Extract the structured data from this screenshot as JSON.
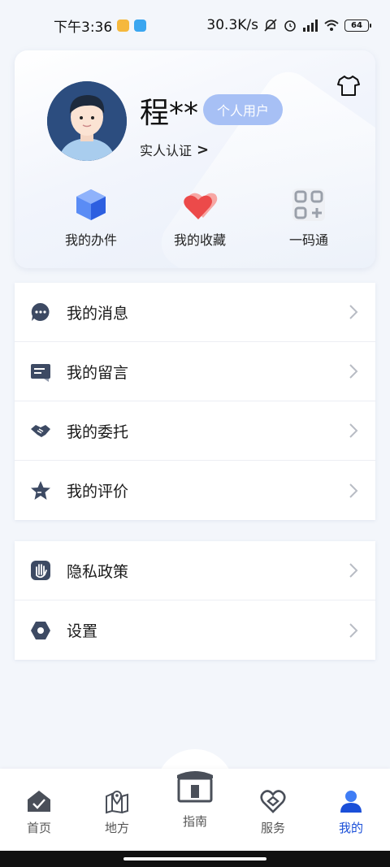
{
  "status": {
    "time": "下午3:36",
    "network_speed": "30.3K/s",
    "battery": "64"
  },
  "profile": {
    "name": "程**",
    "badge": "个人用户",
    "verify_label": "实人认证",
    "verify_arrow": ">"
  },
  "quick_actions": [
    {
      "label": "我的办件",
      "icon": "cube-icon"
    },
    {
      "label": "我的收藏",
      "icon": "hearts-icon"
    },
    {
      "label": "一码通",
      "icon": "qr-code-icon"
    }
  ],
  "menu_group_1": [
    {
      "label": "我的消息",
      "icon": "message-icon"
    },
    {
      "label": "我的留言",
      "icon": "note-icon"
    },
    {
      "label": "我的委托",
      "icon": "handshake-icon"
    },
    {
      "label": "我的评价",
      "icon": "star-icon"
    }
  ],
  "menu_group_2": [
    {
      "label": "隐私政策",
      "icon": "hand-icon"
    },
    {
      "label": "设置",
      "icon": "settings-icon"
    }
  ],
  "tabs": [
    {
      "label": "首页",
      "icon": "home-icon"
    },
    {
      "label": "地方",
      "icon": "map-icon"
    },
    {
      "label": "指南",
      "icon": "guide-book-icon"
    },
    {
      "label": "服务",
      "icon": "heart-service-icon"
    },
    {
      "label": "我的",
      "icon": "user-icon",
      "active": true
    }
  ],
  "colors": {
    "accent": "#1a4fd8",
    "badge_bg": "#a7c0f5",
    "icon_dark": "#3d4a63"
  }
}
